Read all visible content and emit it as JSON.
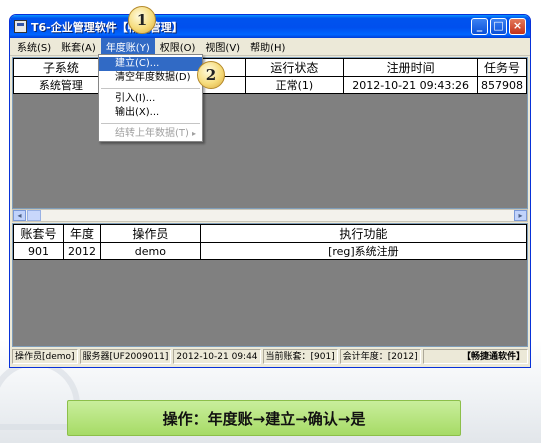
{
  "window": {
    "title": "T6-企业管理软件【畅捷管理】",
    "minimize": "_",
    "maximize": "□",
    "close": "×"
  },
  "menubar": [
    {
      "label": "系统(S)"
    },
    {
      "label": "账套(A)"
    },
    {
      "label": "年度账(Y)"
    },
    {
      "label": "权限(O)"
    },
    {
      "label": "视图(V)"
    },
    {
      "label": "帮助(H)"
    }
  ],
  "top_table": {
    "headers": [
      "子系统",
      "站点",
      "运行状态",
      "注册时间",
      "任务号"
    ],
    "rows": [
      [
        "系统管理",
        "",
        "正常(1)",
        "2012-10-21 09:43:26",
        "857908"
      ]
    ]
  },
  "dropdown": {
    "items": [
      {
        "label": "建立(C)..."
      },
      {
        "label": "清空年度数据(D)"
      },
      {
        "label": "引入(I)..."
      },
      {
        "label": "输出(X)..."
      },
      {
        "label": "结转上年数据(T)"
      }
    ],
    "arrow": "▸"
  },
  "scrollbar": {
    "left": "◂",
    "right": "▸"
  },
  "bottom_table": {
    "headers": [
      "账套号",
      "年度",
      "操作员",
      "执行功能"
    ],
    "rows": [
      [
        "901",
        "2012",
        "demo",
        "[reg]系统注册"
      ]
    ]
  },
  "statusbar": {
    "operator": "操作员[demo]",
    "server": "服务器[UF2009011]",
    "datetime": "2012-10-21 09:44",
    "account": "当前账套：[901]",
    "fiscal_year": "会计年度：[2012]",
    "brand": "【畅捷通软件】"
  },
  "callouts": {
    "one": "1",
    "two": "2"
  },
  "caption": "操作：年度账→建立→确认→是"
}
